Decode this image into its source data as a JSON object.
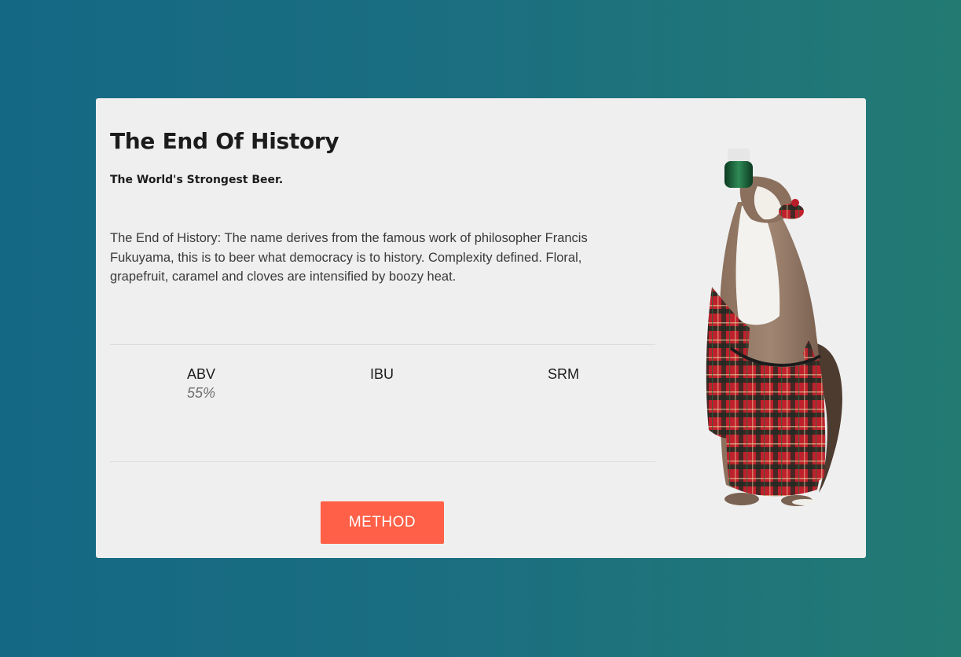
{
  "beer": {
    "name": "The End Of History",
    "tagline": "The World's Strongest Beer.",
    "description": "The End of History: The name derives from the famous work of philosopher Francis Fukuyama, this is to beer what democracy is to history. Complexity defined. Floral, grapefruit, caramel and cloves are intensified by boozy heat."
  },
  "stats": {
    "abv": {
      "label": "ABV",
      "value": "55%"
    },
    "ibu": {
      "label": "IBU",
      "value": ""
    },
    "srm": {
      "label": "SRM",
      "value": ""
    }
  },
  "actions": {
    "method_label": "METHOD"
  },
  "image": {
    "icon": "stuffed-stoat-beer-bottle-image"
  },
  "colors": {
    "background_start": "#156884",
    "background_end": "#237a73",
    "card": "#efefef",
    "accent": "#ff6047"
  }
}
